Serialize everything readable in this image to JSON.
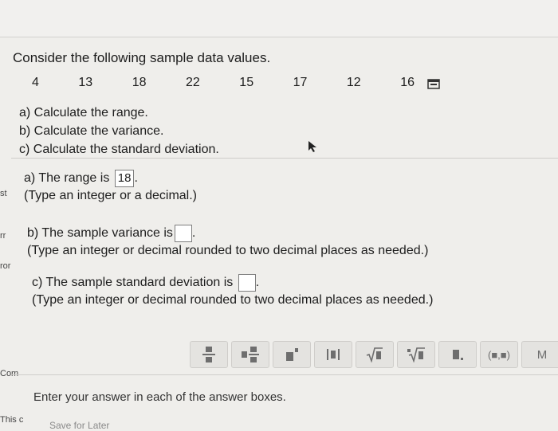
{
  "question": {
    "prompt": "Consider the following sample data values.",
    "values": [
      "4",
      "13",
      "18",
      "22",
      "15",
      "17",
      "12",
      "16"
    ],
    "parts": [
      "a) Calculate the range.",
      "b) Calculate the variance.",
      "c) Calculate the standard deviation."
    ]
  },
  "answers": {
    "a": {
      "label": "a) The range is",
      "value": "18",
      "hint": "(Type an integer or a decimal.)"
    },
    "b": {
      "label": "b) The sample variance is",
      "value": "",
      "hint": "(Type an integer or decimal rounded to two decimal places as needed.)"
    },
    "c": {
      "label": "c) The sample standard deviation is",
      "value": "",
      "hint": "(Type an integer or decimal rounded to two decimal places as needed.)"
    }
  },
  "toolbar": {
    "buttons": [
      "fraction-icon",
      "mixed-number-icon",
      "exponent-icon",
      "absolute-value-icon",
      "square-root-icon",
      "nth-root-icon",
      "decimal-icon",
      "interval-icon"
    ],
    "interval_label": "(■,■)",
    "more_label": "M"
  },
  "footer": {
    "instruction": "Enter your answer in each of the answer boxes.",
    "save_later": "Save for Later"
  },
  "edge_fragments": {
    "e1": "st",
    "e2": "rr",
    "e3": "ror",
    "e4": "Com",
    "e5": "This c"
  }
}
